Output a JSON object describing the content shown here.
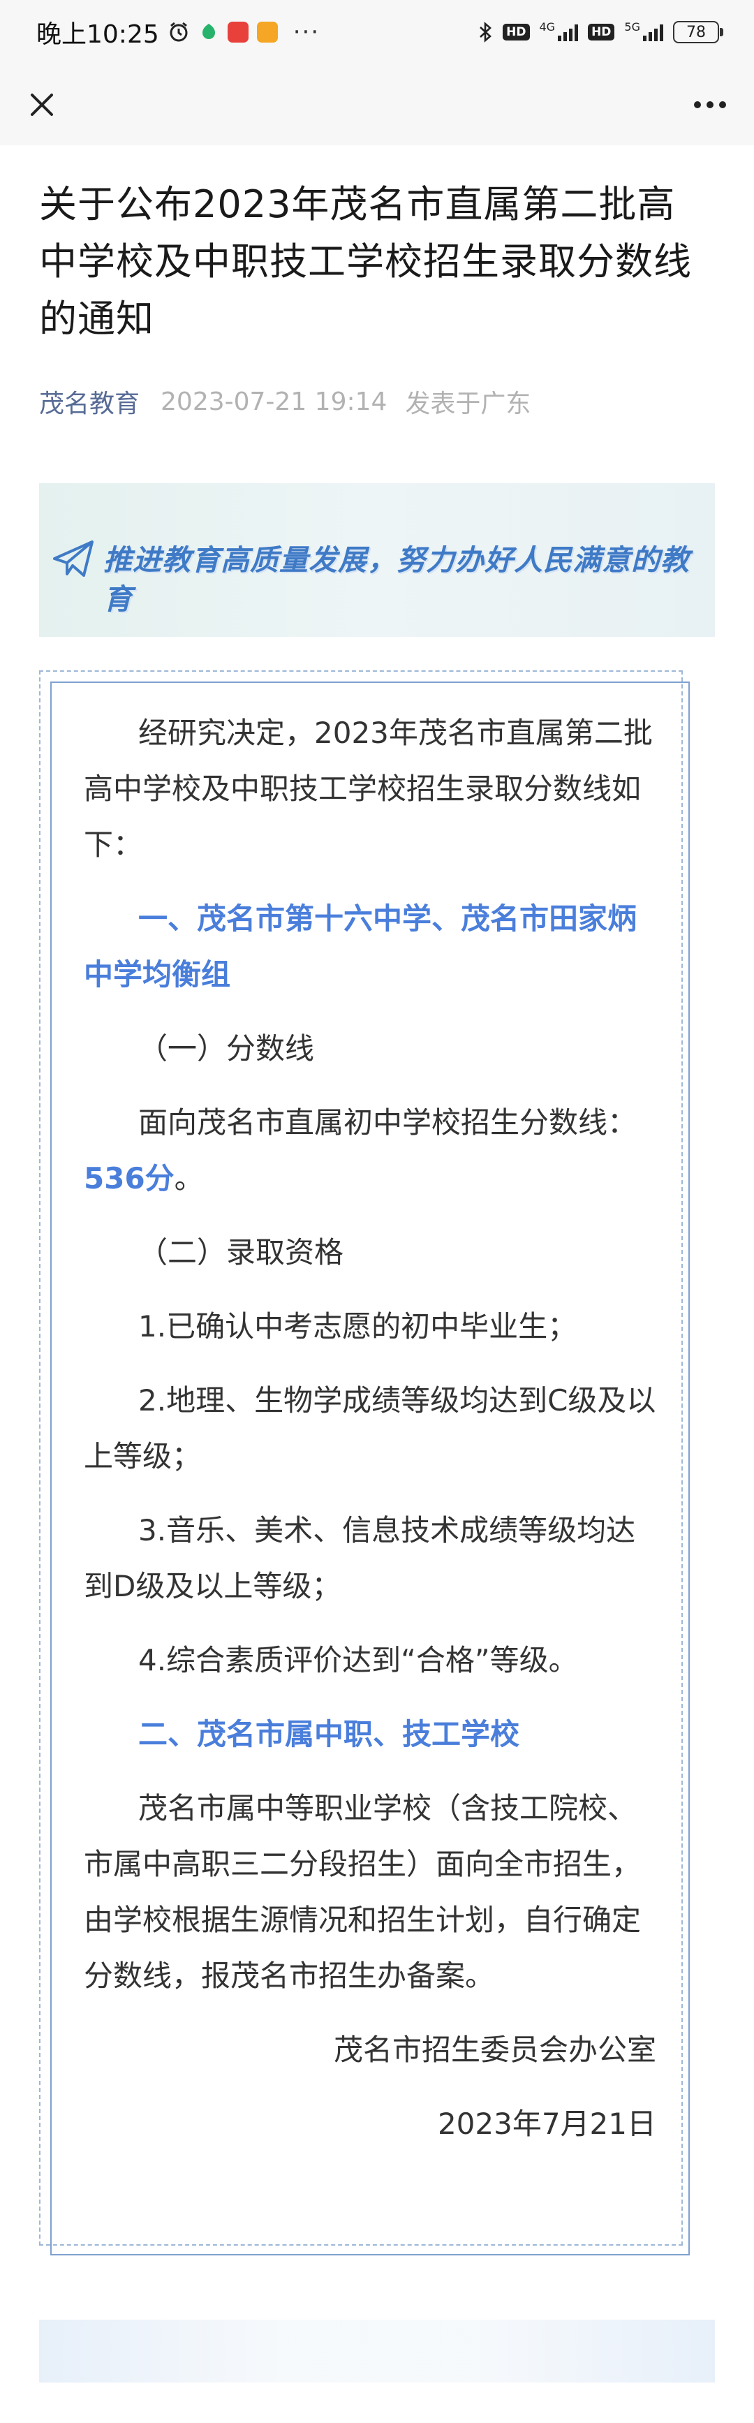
{
  "status_bar": {
    "time": "晚上10:25",
    "network_1": "4G",
    "network_2": "5G",
    "hd_label": "HD",
    "battery": "78",
    "more": "···"
  },
  "nav": {
    "close_icon": "close-icon",
    "more_icon": "more-icon"
  },
  "article": {
    "title": "关于公布2023年茂名市直属第二批高中学校及中职技工学校招生录取分数线的通知",
    "account": "茂名教育",
    "publish_time": "2023-07-21 19:14",
    "location": "发表于广东"
  },
  "banner": {
    "icon": "paper-plane-icon",
    "slogan": "推进教育高质量发展，努力办好人民满意的教育"
  },
  "content": {
    "intro": "经研究决定，2023年茂名市直属第二批高中学校及中职技工学校招生录取分数线如下：",
    "section1_heading": "一、茂名市第十六中学、茂名市田家炳中学均衡组",
    "sub1_heading": "（一）分数线",
    "sub1_text": "面向茂名市直属初中学校招生分数线：",
    "score": "536分",
    "score_suffix": "。",
    "sub2_heading": "（二）录取资格",
    "items": [
      "1.已确认中考志愿的初中毕业生；",
      "2.地理、生物学成绩等级均达到C级及以上等级；",
      "3.音乐、美术、信息技术成绩等级均达到D级及以上等级；",
      "4.综合素质评价达到“合格”等级。"
    ],
    "section2_heading": "二、茂名市属中职、技工学校",
    "section2_text": "茂名市属中等职业学校（含技工院校、市属中高职三二分段招生）面向全市招生，由学校根据生源情况和招生计划，自行确定分数线，报茂名市招生办备案。",
    "signature": "茂名市招生委员会办公室",
    "date": "2023年7月21日"
  },
  "colors": {
    "accent_blue": "#4a7edb",
    "account_link": "#576b95",
    "frame": "#7fa1cf"
  }
}
